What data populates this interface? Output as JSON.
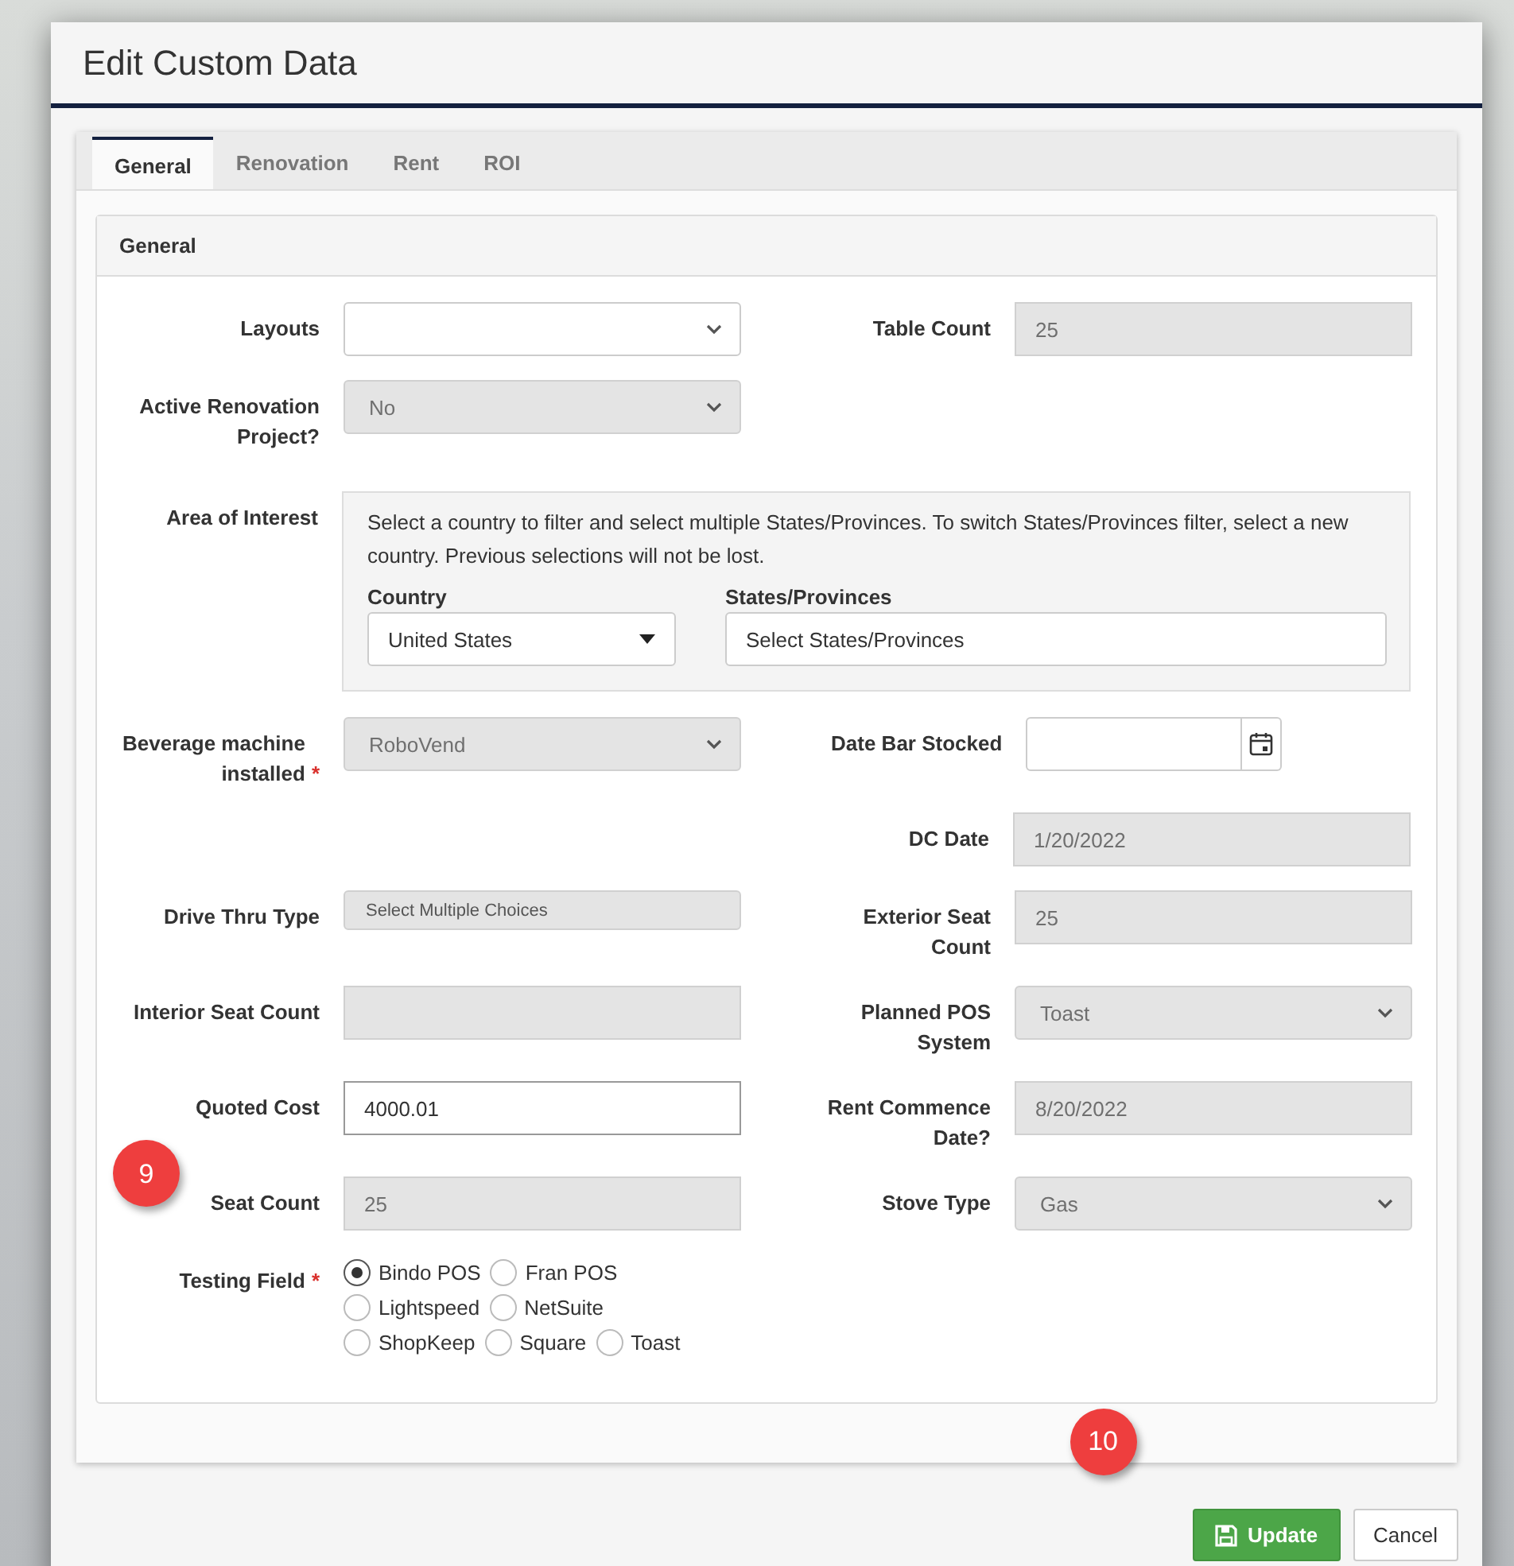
{
  "window": {
    "title": "Edit Custom Data"
  },
  "tabs": [
    {
      "label": "General",
      "selected": true
    },
    {
      "label": "Renovation",
      "selected": false
    },
    {
      "label": "Rent",
      "selected": false
    },
    {
      "label": "ROI",
      "selected": false
    }
  ],
  "section": {
    "title": "General"
  },
  "rows": [
    {
      "left": {
        "kind": "select",
        "label": "Layouts",
        "disabled": false
      },
      "right": {
        "kind": "input",
        "label": "Table Count",
        "value": "25",
        "disabled": true
      }
    },
    {
      "left": {
        "kind": "select",
        "label": "Active Renovation Project?",
        "value": "No",
        "disabled": true
      }
    },
    {
      "left": {
        "kind": "area",
        "label": "Area of Interest",
        "help": "Select a country to filter and select multiple States/Provinces. To switch States/Provinces filter, select a new country. Previous selections will not be lost.",
        "country_label": "Country",
        "country": "United States",
        "states_label": "States/Provinces",
        "states_placeholder": "Select States/Provinces"
      }
    },
    {
      "left": {
        "kind": "select",
        "label": "Beverage machine installed",
        "required_mark": "*",
        "value": "RoboVend",
        "disabled": true
      },
      "right": {
        "kind": "date",
        "label": "Date Bar Stocked",
        "disabled": false
      }
    },
    {
      "right": {
        "kind": "input",
        "label": "DC Date",
        "value": "1/20/2022",
        "disabled": true
      }
    },
    {
      "left": {
        "kind": "multi",
        "label": "Drive Thru Type",
        "placeholder": "Select Multiple Choices",
        "disabled": true
      },
      "right": {
        "kind": "input",
        "label": "Exterior Seat Count",
        "value": "25",
        "disabled": true
      }
    },
    {
      "left": {
        "kind": "input",
        "label": "Interior Seat Count",
        "disabled": true
      },
      "right": {
        "kind": "select",
        "label": "Planned POS System",
        "value": "Toast",
        "disabled": true
      }
    },
    {
      "left": {
        "kind": "input",
        "label": "Quoted Cost",
        "value": "4000.01",
        "disabled": false,
        "callout": "9"
      },
      "right": {
        "kind": "input",
        "label": "Rent Commence Date?",
        "value": "8/20/2022",
        "disabled": true
      }
    },
    {
      "left": {
        "kind": "input",
        "label": "Seat Count",
        "value": "25",
        "disabled": true
      },
      "right": {
        "kind": "select",
        "label": "Stove Type",
        "value": "Gas",
        "disabled": true
      }
    },
    {
      "left": {
        "kind": "radio",
        "label": "Testing Field",
        "required_mark": "*",
        "options": [
          {
            "label": "Bindo POS",
            "selected": true
          },
          {
            "label": "Fran POS",
            "selected": false
          },
          {
            "label": "Lightspeed",
            "selected": false
          },
          {
            "label": "NetSuite",
            "selected": false
          },
          {
            "label": "ShopKeep",
            "selected": false
          },
          {
            "label": "Square",
            "selected": false
          },
          {
            "label": "Toast",
            "selected": false
          }
        ]
      }
    }
  ],
  "footer": {
    "update": {
      "label": "Update",
      "callout": "10"
    },
    "cancel": {
      "label": "Cancel"
    }
  }
}
